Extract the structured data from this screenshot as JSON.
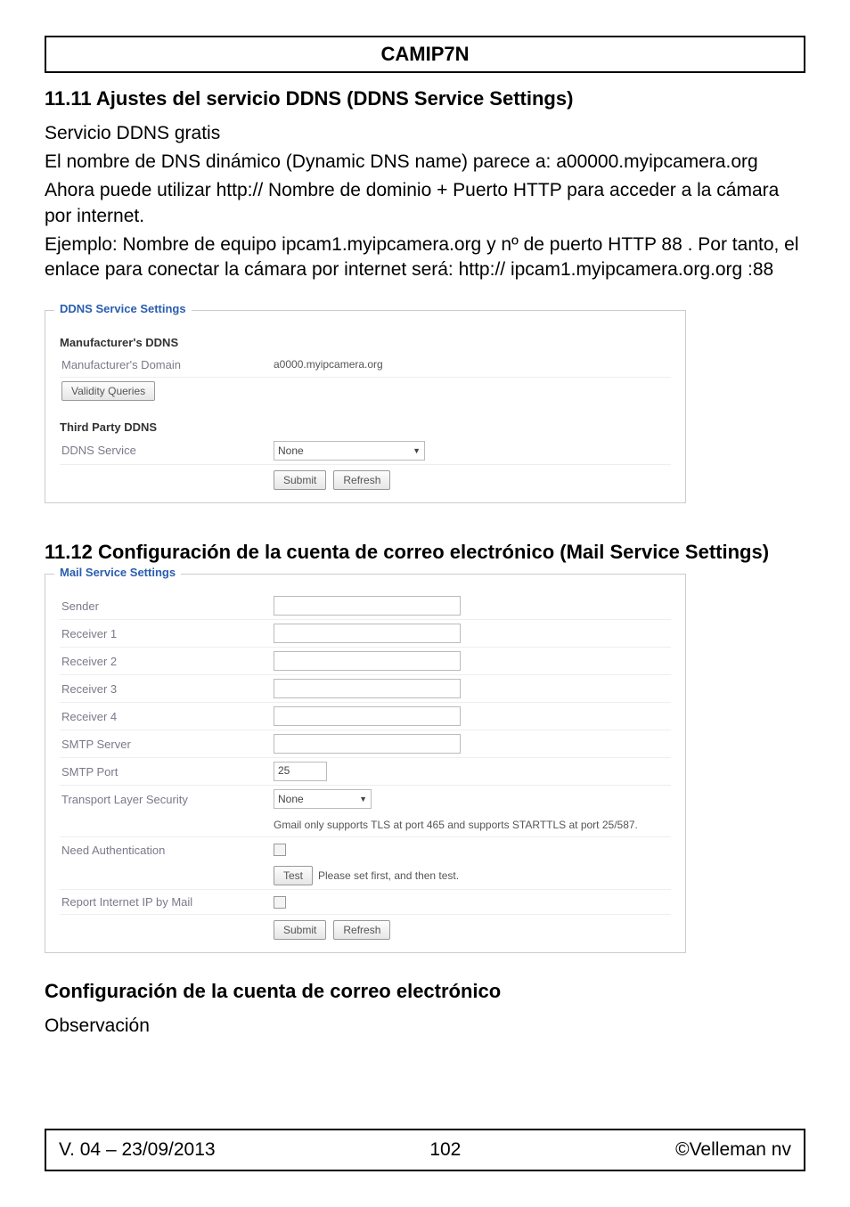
{
  "title": "CAMIP7N",
  "section1": {
    "heading": "11.11 Ajustes del servicio DDNS (DDNS Service Settings)",
    "p1": "Servicio DDNS gratis",
    "p2": "El nombre de DNS dinámico (Dynamic DNS name) parece a: a00000.myipcamera.org",
    "p3": "Ahora  puede utilizar http:// Nombre de dominio  + Puerto HTTP para acceder a la cámara por internet.",
    "p4": "Ejemplo: Nombre de equipo ipcam1.myipcamera.org y nº de puerto HTTP 88 . Por tanto, el enlace para conectar la cámara por internet será: http:// ipcam1.myipcamera.org.org :88"
  },
  "ddns_panel": {
    "legend": "DDNS Service Settings",
    "sub1": "Manufacturer's DDNS",
    "manu_domain_label": "Manufacturer's Domain",
    "manu_domain_value": "a0000.myipcamera.org",
    "validity_btn": "Validity Queries",
    "sub2": "Third Party DDNS",
    "ddns_service_label": "DDNS Service",
    "ddns_service_value": "None",
    "submit": "Submit",
    "refresh": "Refresh"
  },
  "section2": {
    "heading": "11.12 Configuración de la cuenta de correo electrónico (Mail Service Settings)"
  },
  "mail_panel": {
    "legend": "Mail Service Settings",
    "sender": "Sender",
    "r1": "Receiver 1",
    "r2": "Receiver 2",
    "r3": "Receiver 3",
    "r4": "Receiver 4",
    "smtp_server": "SMTP Server",
    "smtp_port": "SMTP Port",
    "smtp_port_value": "25",
    "tls_label": "Transport Layer Security",
    "tls_value": "None",
    "tls_hint": "Gmail only supports TLS at port 465 and supports STARTTLS at port 25/587.",
    "need_auth": "Need Authentication",
    "test": "Test",
    "test_hint": "Please set first, and then test.",
    "report_ip": "Report Internet IP by Mail",
    "submit": "Submit",
    "refresh": "Refresh"
  },
  "section3": {
    "heading": "Configuración de la cuenta de correo electrónico",
    "obs": "Observación"
  },
  "footer": {
    "left": "V. 04 – 23/09/2013",
    "mid": "102",
    "right": "©Velleman nv"
  }
}
